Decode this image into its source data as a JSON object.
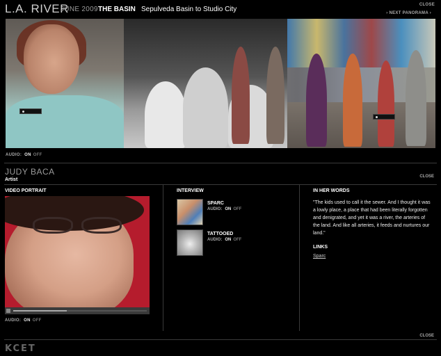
{
  "header": {
    "site_title": "L.A. RIVER",
    "date": "JUNE 2009",
    "section": "THE BASIN",
    "section_subtitle": "Sepulveda Basin to Studio City",
    "close": "CLOSE",
    "next_panorama": "› NEXT PANORAMA ›"
  },
  "panorama_audio": {
    "label": "AUDIO:",
    "on": "ON",
    "off": "OFF"
  },
  "person": {
    "name": "JUDY BACA",
    "role": "Artist",
    "close": "CLOSE"
  },
  "video_portrait": {
    "title": "VIDEO PORTRAIT",
    "progress": 0.4,
    "audio": {
      "label": "AUDIO:",
      "on": "ON",
      "off": "OFF"
    }
  },
  "interview": {
    "title": "INTERVIEW",
    "items": [
      {
        "title": "SPARC",
        "audio_label": "AUDIO:",
        "on": "ON",
        "off": "OFF"
      },
      {
        "title": "TATTOOED",
        "audio_label": "AUDIO:",
        "on": "ON",
        "off": "OFF"
      }
    ]
  },
  "in_her_words": {
    "title": "IN HER WORDS",
    "quote": "\"The kids used to call it the sewer. And I thought it was a lowly place, a place that had been literally forgotten and denigrated, and yet it was a river, the arteries of the land. And like all arteries, it feeds and nurtures our land.\"",
    "links_title": "LINKS",
    "links": [
      "Sparc"
    ]
  },
  "footer": {
    "close": "CLOSE",
    "logo": "KCET"
  },
  "colors": {
    "background": "#000000",
    "video_backdrop": "#b51c2d"
  }
}
